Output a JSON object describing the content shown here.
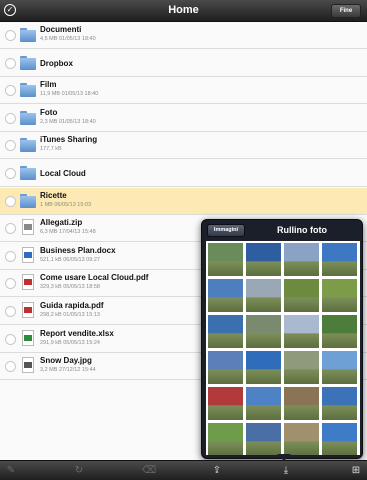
{
  "navbar": {
    "title": "Home",
    "done_label": "Fine"
  },
  "files": [
    {
      "name": "Documenti",
      "meta": "4,5 MB 01/05/13 18:40",
      "type": "folder",
      "selected": false
    },
    {
      "name": "Dropbox",
      "meta": "",
      "type": "folder",
      "selected": false
    },
    {
      "name": "Film",
      "meta": "11,9 MB 01/05/13 18:40",
      "type": "folder",
      "selected": false
    },
    {
      "name": "Foto",
      "meta": "2,3 MB 01/05/13 18:40",
      "type": "folder",
      "selected": false
    },
    {
      "name": "iTunes Sharing",
      "meta": "177,7 kB",
      "type": "folder",
      "selected": false
    },
    {
      "name": "Local Cloud",
      "meta": "",
      "type": "folder",
      "selected": false
    },
    {
      "name": "Ricette",
      "meta": "1 MB 06/05/13 15:03",
      "type": "folder",
      "selected": true
    },
    {
      "name": "Allegati.zip",
      "meta": "6,3 MB 17/04/13 15:48",
      "type": "zip",
      "selected": false
    },
    {
      "name": "Business Plan.docx",
      "meta": "521,1 kB 06/05/13 09:27",
      "type": "docx",
      "selected": false
    },
    {
      "name": "Come usare Local Cloud.pdf",
      "meta": "329,3 kB 05/05/13 18:58",
      "type": "pdf",
      "selected": false
    },
    {
      "name": "Guida rapida.pdf",
      "meta": "298,2 kB 01/05/13 15:13",
      "type": "pdf",
      "selected": false
    },
    {
      "name": "Report vendite.xlsx",
      "meta": "291,9 kB 05/05/13 15:24",
      "type": "xlsx",
      "selected": false
    },
    {
      "name": "Snow Day.jpg",
      "meta": "3,2 MB 27/12/12 15:44",
      "type": "jpg",
      "selected": false
    }
  ],
  "popover": {
    "back_label": "Immagini",
    "title": "Rullino foto",
    "photos": [
      [
        "#6a8b5a",
        "#2f5ea0",
        "#8aa3c4",
        "#3f78c2"
      ],
      [
        "#4d7fbf",
        "#9aa7b4",
        "#6c8b3f",
        "#7c9c4a"
      ],
      [
        "#3c6fae",
        "#7a8a6e",
        "#a9b9cf",
        "#4c7d3a"
      ],
      [
        "#5b7fb8",
        "#2f6dbb",
        "#8f9a7a",
        "#6ea0d6"
      ],
      [
        "#b23a3a",
        "#4f82c4",
        "#8b7355",
        "#3b72b8"
      ],
      [
        "#6e9c4a",
        "#4a6fa5",
        "#a1906e",
        "#3f7cc7"
      ]
    ]
  },
  "toolbar": {
    "icons": [
      "pencil-icon",
      "refresh-icon",
      "trash-icon",
      "share-icon",
      "upload-icon",
      "add-folder-icon"
    ]
  }
}
